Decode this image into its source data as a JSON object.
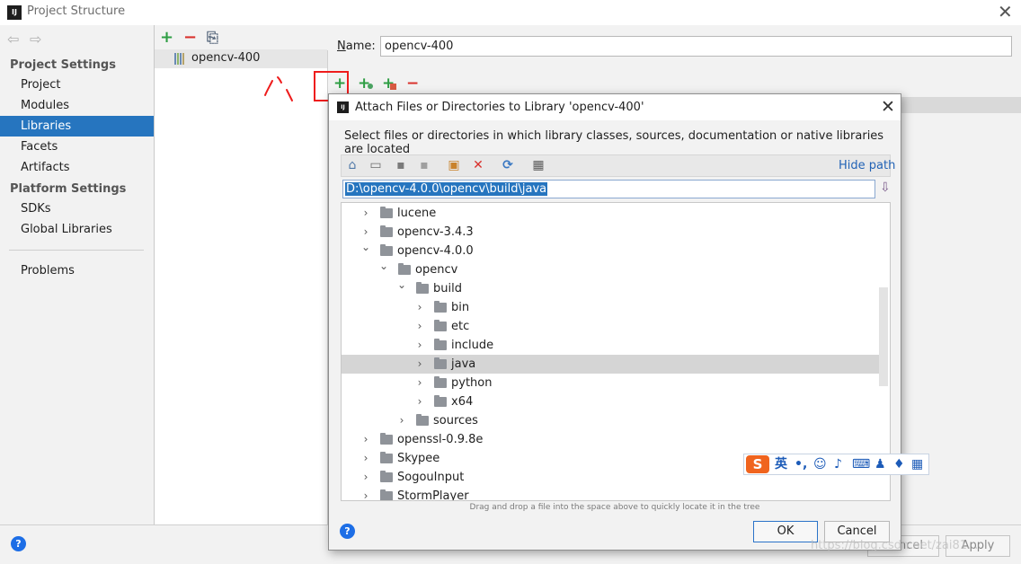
{
  "window": {
    "title": "Project Structure",
    "close_glyph": "✕"
  },
  "nav": {
    "back_glyph": "⇦",
    "forward_glyph": "⇨"
  },
  "sidebar": {
    "project_settings_heading": "Project Settings",
    "project_items": [
      {
        "label": "Project",
        "selected": false
      },
      {
        "label": "Modules",
        "selected": false
      },
      {
        "label": "Libraries",
        "selected": true
      },
      {
        "label": "Facets",
        "selected": false
      },
      {
        "label": "Artifacts",
        "selected": false
      }
    ],
    "platform_settings_heading": "Platform Settings",
    "platform_items": [
      {
        "label": "SDKs"
      },
      {
        "label": "Global Libraries"
      }
    ],
    "problems_label": "Problems"
  },
  "library_list": {
    "toolbar": {
      "add_glyph": "+",
      "remove_glyph": "−",
      "copy_glyph": "⎘"
    },
    "items": [
      {
        "label": "opencv-400",
        "selected": true
      }
    ]
  },
  "library_detail": {
    "name_label_prefix": "N",
    "name_label_rest": "ame:",
    "name_value": "opencv-400",
    "toolbar": {
      "add_glyph": "+",
      "add_spec_glyph": "+",
      "add_jar_glyph": "+",
      "remove_glyph": "−"
    }
  },
  "dialog": {
    "title": "Attach Files or Directories to Library 'opencv-400'",
    "close_glyph": "✕",
    "description": "Select files or directories in which library classes, sources, documentation or native libraries are located",
    "toolbar": {
      "home_glyph": "⌂",
      "desktop_glyph": "▭",
      "project_glyph": "▪",
      "module_glyph": "▪",
      "new_folder_glyph": "▣",
      "delete_glyph": "✕",
      "refresh_glyph": "⟳",
      "show_hidden_glyph": "▦"
    },
    "hide_path_label": "Hide path",
    "path_value": "D:\\opencv-4.0.0\\opencv\\build\\java",
    "bookmark_glyph": "⇩",
    "tree": [
      {
        "label": "lucene",
        "depth": 0,
        "expanded": false,
        "selected": false
      },
      {
        "label": "opencv-3.4.3",
        "depth": 0,
        "expanded": false,
        "selected": false
      },
      {
        "label": "opencv-4.0.0",
        "depth": 0,
        "expanded": true,
        "selected": false
      },
      {
        "label": "opencv",
        "depth": 1,
        "expanded": true,
        "selected": false
      },
      {
        "label": "build",
        "depth": 2,
        "expanded": true,
        "selected": false
      },
      {
        "label": "bin",
        "depth": 3,
        "expanded": false,
        "selected": false
      },
      {
        "label": "etc",
        "depth": 3,
        "expanded": false,
        "selected": false
      },
      {
        "label": "include",
        "depth": 3,
        "expanded": false,
        "selected": false
      },
      {
        "label": "java",
        "depth": 3,
        "expanded": false,
        "selected": true
      },
      {
        "label": "python",
        "depth": 3,
        "expanded": false,
        "selected": false
      },
      {
        "label": "x64",
        "depth": 3,
        "expanded": false,
        "selected": false
      },
      {
        "label": "sources",
        "depth": 2,
        "expanded": false,
        "selected": false
      },
      {
        "label": "openssl-0.9.8e",
        "depth": 0,
        "expanded": false,
        "selected": false
      },
      {
        "label": "Skypee",
        "depth": 0,
        "expanded": false,
        "selected": false
      },
      {
        "label": "SogouInput",
        "depth": 0,
        "expanded": false,
        "selected": false
      },
      {
        "label": "StormPlayer",
        "depth": 0,
        "expanded": false,
        "selected": false
      }
    ],
    "drag_hint": "Drag and drop a file into the space above to quickly locate it in the tree",
    "help_glyph": "?",
    "ok_label": "OK",
    "cancel_label": "Cancel"
  },
  "footer": {
    "help_glyph": "?",
    "cancel_label": "Cancel",
    "apply_label": "Apply"
  },
  "ime_toolbar": {
    "logo_glyph": "S",
    "mode_label": "英",
    "punct_glyph": "•,",
    "emoji_glyph": "☺",
    "mic_glyph": "♪",
    "keyboard_glyph": "⌨",
    "user_glyph": "♟",
    "skin_glyph": "♦",
    "apps_glyph": "▦"
  },
  "watermark": "https://blog.csdn.net/zai81..."
}
